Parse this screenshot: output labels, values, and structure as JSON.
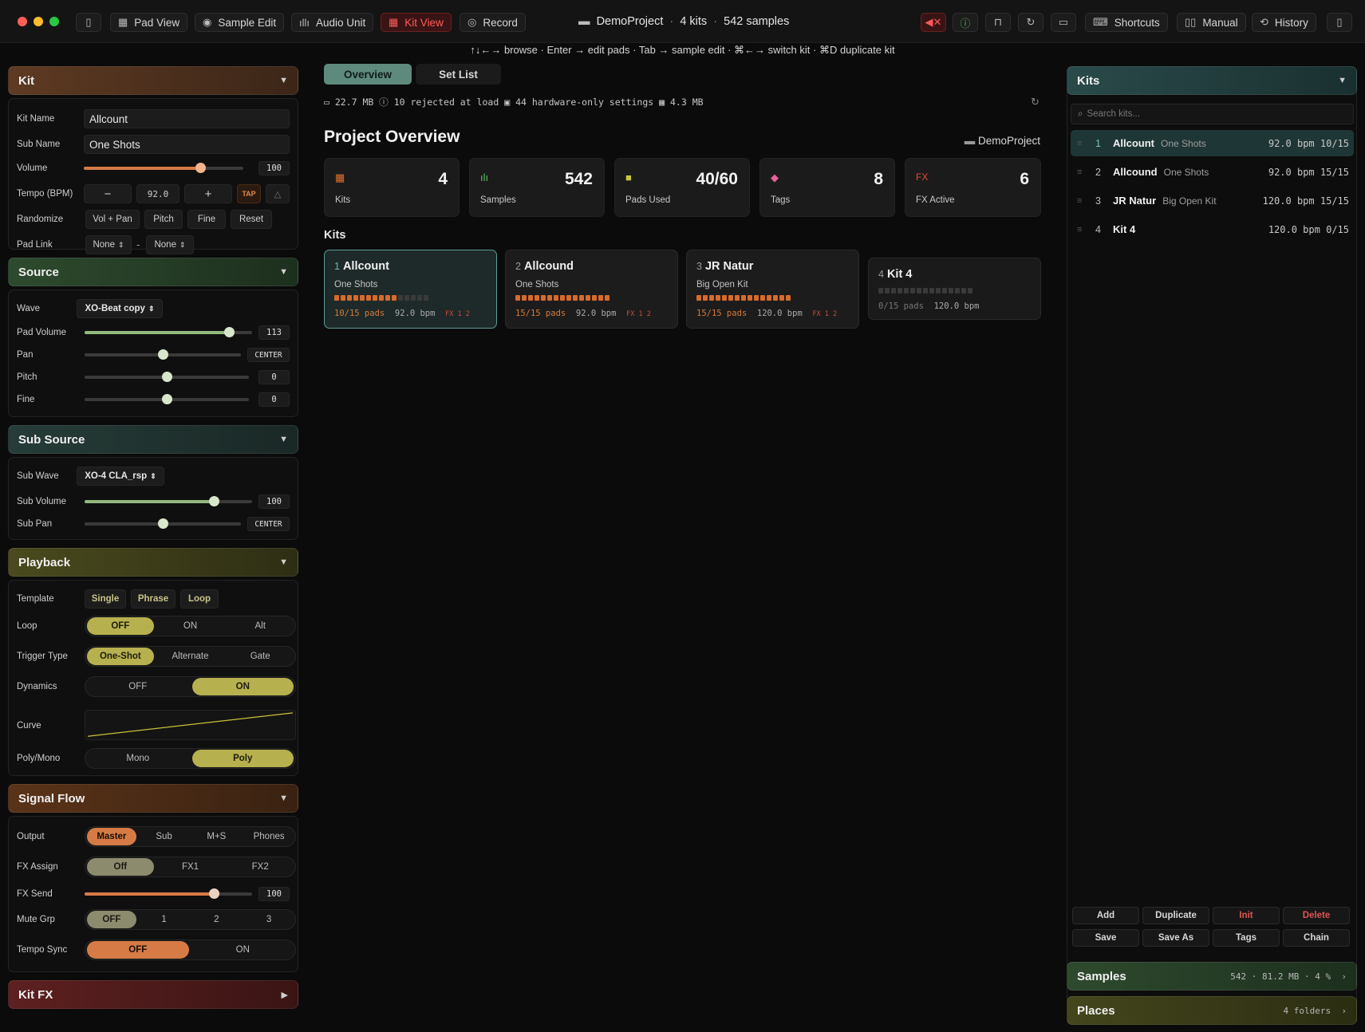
{
  "titlebar": {
    "buttons": [
      "Pad View",
      "Sample Edit",
      "Audio Unit",
      "Kit View",
      "Record"
    ],
    "project": "DemoProject",
    "kits_count": "4 kits",
    "samples_count": "542 samples",
    "right_buttons": [
      "Shortcuts",
      "Manual",
      "History"
    ]
  },
  "hints": "↑↓←→ browse · Enter → edit pads · Tab → sample edit · ⌘←→ switch kit · ⌘D duplicate kit",
  "kit": {
    "title": "Kit",
    "name_label": "Kit Name",
    "name_value": "Allcount",
    "sub_label": "Sub Name",
    "sub_value": "One Shots",
    "volume_label": "Volume",
    "volume_value": "100",
    "volume_level": 0.73,
    "tempo_label": "Tempo (BPM)",
    "tempo_minus": "−",
    "tempo_value": "92.0",
    "tempo_plus": "+",
    "tap": "TAP",
    "randomize_label": "Randomize",
    "randomize": [
      "Vol + Pan",
      "Pitch",
      "Fine",
      "Reset"
    ],
    "padlink_label": "Pad Link",
    "padlink_a": "None",
    "padlink_dash": "-",
    "padlink_b": "None"
  },
  "source": {
    "title": "Source",
    "wave_label": "Wave",
    "wave_value": "XO-Beat copy",
    "padvol_label": "Pad Volume",
    "padvol_value": "113",
    "padvol_level": 0.86,
    "pan_label": "Pan",
    "pan_value": "CENTER",
    "pan_level": 0.5,
    "pitch_label": "Pitch",
    "pitch_value": "0",
    "pitch_level": 0.5,
    "fine_label": "Fine",
    "fine_value": "0",
    "fine_level": 0.5
  },
  "subsource": {
    "title": "Sub Source",
    "wave_label": "Sub Wave",
    "wave_value": "XO-4 CLA_rsp",
    "vol_label": "Sub Volume",
    "vol_value": "100",
    "vol_level": 0.77,
    "pan_label": "Sub Pan",
    "pan_value": "CENTER",
    "pan_level": 0.5
  },
  "playback": {
    "title": "Playback",
    "template_label": "Template",
    "templates": [
      "Single",
      "Phrase",
      "Loop"
    ],
    "loop_label": "Loop",
    "loop_opts": [
      "OFF",
      "ON",
      "Alt"
    ],
    "trigger_label": "Trigger Type",
    "trigger_opts": [
      "One-Shot",
      "Alternate",
      "Gate"
    ],
    "dynamics_label": "Dynamics",
    "dynamics_opts": [
      "OFF",
      "ON"
    ],
    "curve_label": "Curve",
    "poly_label": "Poly/Mono",
    "poly_opts": [
      "Mono",
      "Poly"
    ]
  },
  "signal": {
    "title": "Signal Flow",
    "output_label": "Output",
    "output_opts": [
      "Master",
      "Sub",
      "M+S",
      "Phones"
    ],
    "fxassign_label": "FX Assign",
    "fxassign_opts": [
      "Off",
      "FX1",
      "FX2"
    ],
    "fxsend_label": "FX Send",
    "fxsend_value": "100",
    "fxsend_level": 0.77,
    "mute_label": "Mute Grp",
    "mute_opts": [
      "OFF",
      "1",
      "2",
      "3"
    ],
    "tsync_label": "Tempo Sync",
    "tsync_opts": [
      "OFF",
      "ON"
    ]
  },
  "kitfx": {
    "title": "Kit FX"
  },
  "center": {
    "tabs": [
      "Overview",
      "Set List"
    ],
    "stats_line": {
      "size": "22.7 MB",
      "rejected": "10 rejected at load",
      "hw": "44 hardware-only settings",
      "grid": "4.3 MB"
    },
    "title": "Project Overview",
    "project": "DemoProject",
    "cards": [
      {
        "value": "4",
        "label": "Kits",
        "color": "#e8702a"
      },
      {
        "value": "542",
        "label": "Samples",
        "color": "#5fbf60"
      },
      {
        "value": "40/60",
        "label": "Pads Used",
        "color": "#c8c83a"
      },
      {
        "value": "8",
        "label": "Tags",
        "color": "#e8609a"
      },
      {
        "value": "6",
        "label": "FX Active",
        "color": "#e24a3a",
        "icon_text": "FX"
      }
    ],
    "kits_heading": "Kits",
    "kits": [
      {
        "idx": "1",
        "name": "Allcount",
        "sub": "One Shots",
        "used": 10,
        "pads": "10/15 pads",
        "bpm": "92.0 bpm",
        "fx": "FX 1 2"
      },
      {
        "idx": "2",
        "name": "Allcound",
        "sub": "One Shots",
        "used": 15,
        "pads": "15/15 pads",
        "bpm": "92.0 bpm",
        "fx": "FX 1 2"
      },
      {
        "idx": "3",
        "name": "JR Natur",
        "sub": "Big Open Kit",
        "used": 15,
        "pads": "15/15 pads",
        "bpm": "120.0 bpm",
        "fx": "FX 1 2"
      },
      {
        "idx": "4",
        "name": "Kit 4",
        "sub": "",
        "used": 0,
        "pads": "0/15 pads",
        "bpm": "120.0 bpm",
        "fx": ""
      }
    ]
  },
  "right": {
    "kits_title": "Kits",
    "search_placeholder": "Search kits...",
    "list": [
      {
        "n": "1",
        "name": "Allcount",
        "sub": "One Shots",
        "bpm": "92.0 bpm",
        "pads": "10/15"
      },
      {
        "n": "2",
        "name": "Allcound",
        "sub": "One Shots",
        "bpm": "92.0 bpm",
        "pads": "15/15"
      },
      {
        "n": "3",
        "name": "JR Natur",
        "sub": "Big Open Kit",
        "bpm": "120.0 bpm",
        "pads": "15/15"
      },
      {
        "n": "4",
        "name": "Kit 4",
        "sub": "",
        "bpm": "120.0 bpm",
        "pads": "0/15"
      }
    ],
    "actions": [
      "Add",
      "Duplicate",
      "Init",
      "Delete",
      "Save",
      "Save As",
      "Tags",
      "Chain"
    ],
    "samples_title": "Samples",
    "samples_meta": "542 · 81.2 MB · 4 %",
    "places_title": "Places",
    "places_meta": "4 folders"
  }
}
